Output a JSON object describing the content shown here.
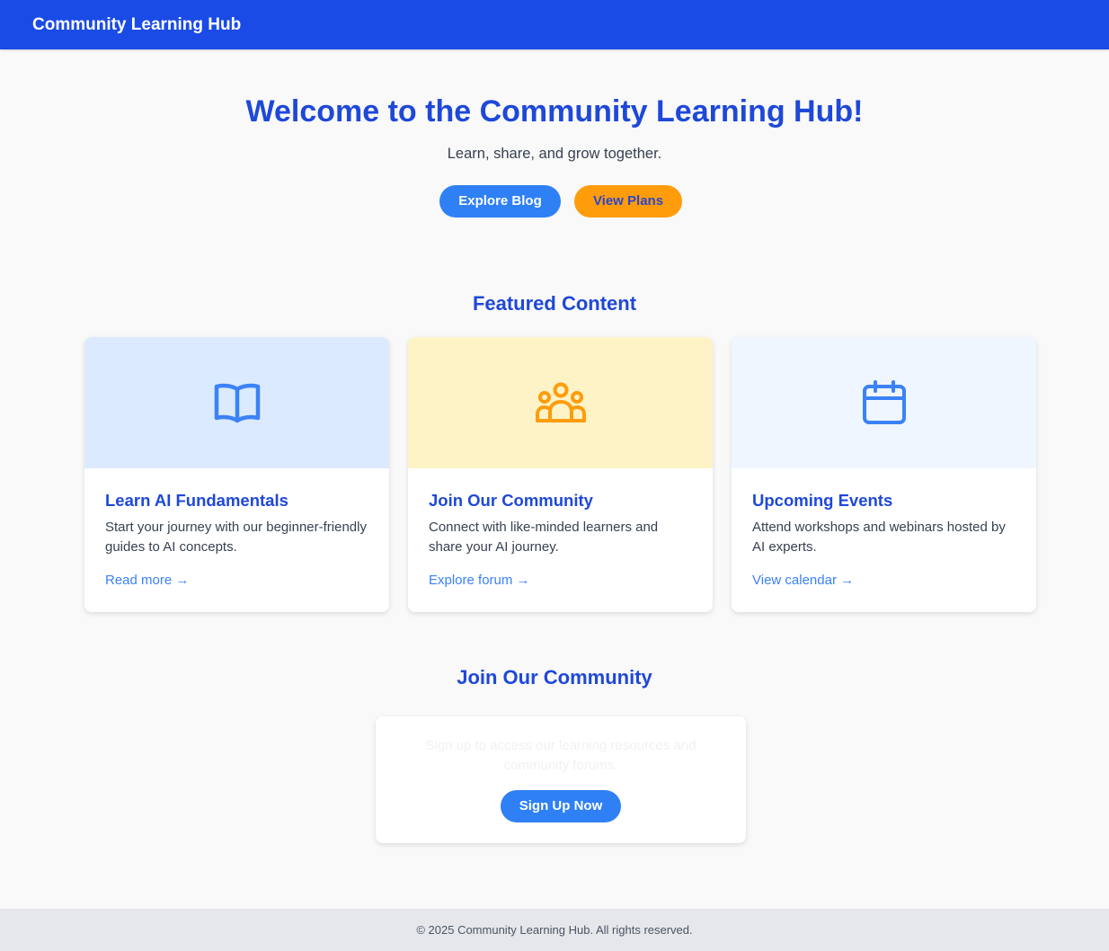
{
  "header": {
    "brand": "Community Learning Hub",
    "background_color": "#1a4be6"
  },
  "hero": {
    "title": "Welcome to the Community Learning Hub!",
    "subtitle": "Learn, share, and grow together.",
    "explore_blog_label": "Explore Blog",
    "view_plans_label": "View Plans"
  },
  "featured": {
    "title": "Featured Content",
    "cards": [
      {
        "icon": "book-open-icon",
        "banner_color": "#dbeafe",
        "icon_color": "#3b82f6",
        "title": "Learn AI Fundamentals",
        "description": "Start your journey with our beginner-friendly guides to AI concepts.",
        "link": "Read more →"
      },
      {
        "icon": "user-group-icon",
        "banner_color": "#fef3c7",
        "icon_color": "#ff9c0c",
        "title": "Join Our Community",
        "description": "Connect with like-minded learners and share your AI journey.",
        "link": "Explore forum →"
      },
      {
        "icon": "calendar-icon",
        "banner_color": "#eff6ff",
        "icon_color": "#3b82f6",
        "title": "Upcoming Events",
        "description": "Attend workshops and webinars hosted by AI experts.",
        "link": "View calendar →"
      }
    ]
  },
  "community": {
    "title": "Join Our Community",
    "text": "Sign up to access our learning resources and community forums.",
    "signup_label": "Sign Up Now"
  },
  "footer": {
    "text": "© 2025 Community Learning Hub. All rights reserved."
  },
  "colors": {
    "accent_blue": "#1e48d8",
    "button_blue": "#2f80f5",
    "button_orange": "#ff9c0c",
    "link_blue": "#3b82f6"
  }
}
